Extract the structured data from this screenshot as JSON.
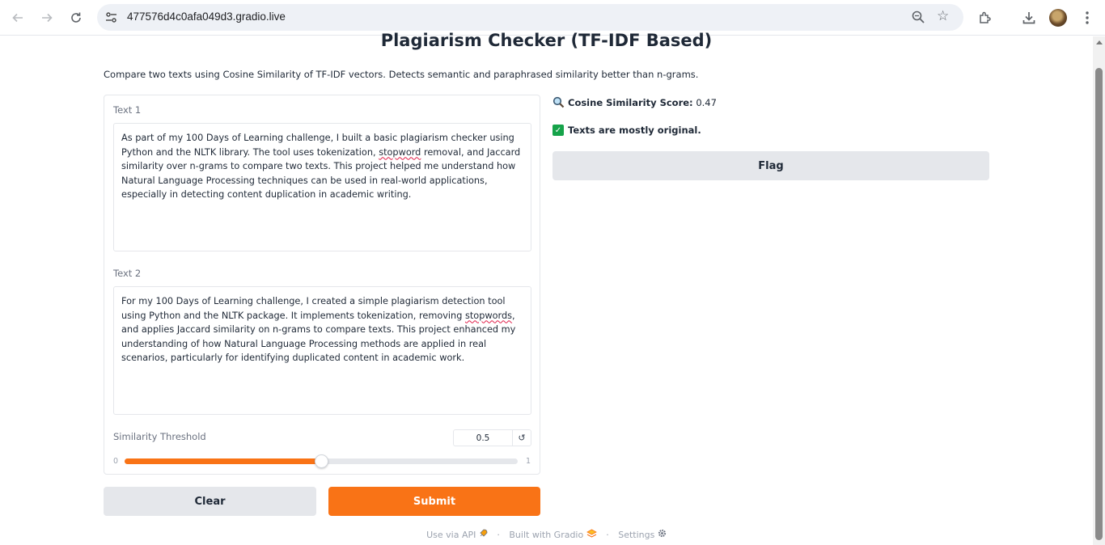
{
  "browser": {
    "url": "477576d4c0afa049d3.gradio.live"
  },
  "app": {
    "title": "Plagiarism Checker (TF-IDF Based)",
    "description": "Compare two texts using Cosine Similarity of TF-IDF vectors. Detects semantic and paraphrased similarity better than n-grams."
  },
  "inputs": {
    "text1": {
      "label": "Text 1",
      "value_before_1": "As part of my 100 Days of Learning challenge, I built a basic plagiarism checker using Python and the NLTK library. The tool uses tokenization, ",
      "value_flagged_1": "stopword",
      "value_after_1": " removal, and Jaccard similarity over n-grams to compare two texts. This project helped me understand how Natural Language Processing techniques can be used in real-world applications, especially in detecting content duplication in academic writing."
    },
    "text2": {
      "label": "Text 2",
      "value_before_1": "For my 100 Days of Learning challenge, I created a simple plagiarism detection tool using Python and the NLTK package. It implements tokenization, removing ",
      "value_flagged_1": "stopwords",
      "value_after_1": ", and applies Jaccard similarity on n-grams to compare texts. This project enhanced my understanding of how Natural Language Processing methods are applied in real scenarios, particularly for identifying duplicated content in academic work."
    },
    "threshold": {
      "label": "Similarity Threshold",
      "value": "0.5",
      "value_fraction": 0.5,
      "min": "0",
      "max": "1",
      "reset_icon": "↺"
    }
  },
  "buttons": {
    "clear": "Clear",
    "submit": "Submit",
    "flag": "Flag"
  },
  "results": {
    "score_label": "Cosine Similarity Score:",
    "score_value": "0.47",
    "verdict": "Texts are mostly original.",
    "score_icon": "magnifying-glass-icon",
    "verdict_icon": "check-mark-icon"
  },
  "footer": {
    "api": "Use via API",
    "separator": "·",
    "built": "Built with Gradio",
    "settings": "Settings"
  },
  "colors": {
    "primary": "#f97316",
    "secondary": "#e5e7eb",
    "success": "#16a34a"
  }
}
